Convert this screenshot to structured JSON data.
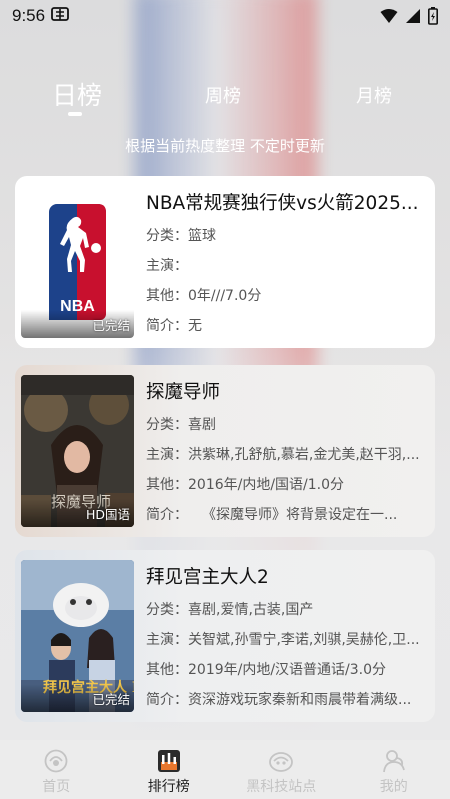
{
  "status_bar": {
    "time": "9:56",
    "notification_icon": "app-notification-icon"
  },
  "tabs": [
    {
      "label": "日榜",
      "active": true
    },
    {
      "label": "周榜",
      "active": false
    },
    {
      "label": "月榜",
      "active": false
    }
  ],
  "subtitle": "根据当前热度整理 不定时更新",
  "items": [
    {
      "title": "NBA常规赛独行侠vs火箭2025...",
      "category_label": "分类：",
      "category": "篮球",
      "cast_label": "主演：",
      "cast": "",
      "other_label": "其他：",
      "other": "0年///7.0分",
      "intro_label": "简介：",
      "intro": "无",
      "badge": "已完结"
    },
    {
      "title": "探魔导师",
      "category_label": "分类：",
      "category": "喜剧",
      "cast_label": "主演：",
      "cast": "洪紫琳,孔舒航,慕岩,金尤美,赵干羽,...",
      "other_label": "其他：",
      "other": "2016年/内地/国语/1.0分",
      "intro_label": "简介：",
      "intro": "　　《探魔导师》将背景设定在一...",
      "badge": "HD国语",
      "poster_text": "探魔导师"
    },
    {
      "title": "拜见宫主大人2",
      "category_label": "分类：",
      "category": "喜剧,爱情,古装,国产",
      "cast_label": "主演：",
      "cast": "关智斌,孙雪宁,李诺,刘骐,吴赫伦,卫...",
      "other_label": "其他：",
      "other": "2019年/内地/汉语普通话/3.0分",
      "intro_label": "简介：",
      "intro": "资深游戏玩家秦新和雨晨带着满级...",
      "badge": "已完结",
      "poster_text": "拜见宫主大人 II"
    }
  ],
  "bottom_nav": [
    {
      "label": "首页",
      "icon": "home-icon",
      "active": false
    },
    {
      "label": "排行榜",
      "icon": "ranking-icon",
      "active": true
    },
    {
      "label": "黑科技站点",
      "icon": "tech-site-icon",
      "active": false
    },
    {
      "label": "我的",
      "icon": "profile-icon",
      "active": false
    }
  ],
  "colors": {
    "accent_orange": "#e8772e",
    "nba_blue": "#1d428a",
    "nba_red": "#c8102e"
  }
}
